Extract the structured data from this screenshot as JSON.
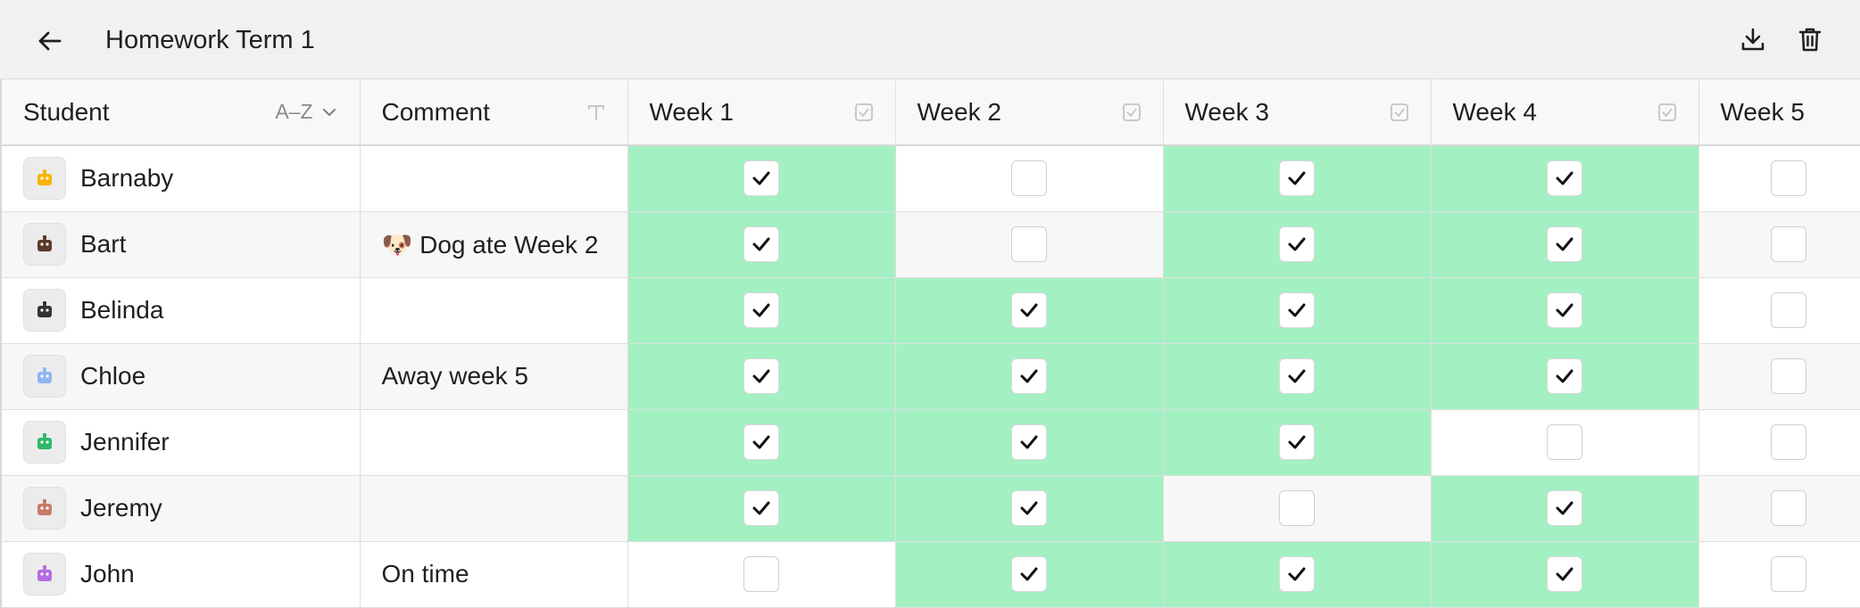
{
  "header": {
    "title": "Homework Term 1",
    "back_icon": "arrow-left-icon",
    "download_icon": "download-icon",
    "delete_icon": "trash-icon"
  },
  "columns": {
    "student": "Student",
    "sort_label": "A–Z",
    "comment": "Comment",
    "weeks": [
      "Week 1",
      "Week 2",
      "Week 3",
      "Week 4",
      "Week 5"
    ]
  },
  "colors": {
    "checked_bg": "#a3f0c3",
    "unchecked_bg": "#ffffff"
  },
  "rows": [
    {
      "name": "Barnaby",
      "avatar": "robot-avatar-icon",
      "avatar_color": "#f5b400",
      "comment": "",
      "weeks": [
        true,
        false,
        true,
        true,
        false
      ]
    },
    {
      "name": "Bart",
      "avatar": "bag-avatar-icon",
      "avatar_color": "#5a3a2a",
      "comment": "🐶 Dog ate Week 2",
      "weeks": [
        true,
        false,
        true,
        true,
        false
      ]
    },
    {
      "name": "Belinda",
      "avatar": "bear-avatar-icon",
      "avatar_color": "#333333",
      "comment": "",
      "weeks": [
        true,
        true,
        true,
        true,
        false
      ]
    },
    {
      "name": "Chloe",
      "avatar": "unicorn-avatar-icon",
      "avatar_color": "#8fb6f0",
      "comment": "Away week 5",
      "weeks": [
        true,
        true,
        true,
        true,
        false
      ]
    },
    {
      "name": "Jennifer",
      "avatar": "dragon-avatar-icon",
      "avatar_color": "#2fb86a",
      "comment": "",
      "weeks": [
        true,
        true,
        true,
        false,
        false
      ]
    },
    {
      "name": "Jeremy",
      "avatar": "fox-avatar-icon",
      "avatar_color": "#c77a6a",
      "comment": "",
      "weeks": [
        true,
        true,
        false,
        true,
        false
      ]
    },
    {
      "name": "John",
      "avatar": "monster-avatar-icon",
      "avatar_color": "#b46de0",
      "comment": "On time",
      "weeks": [
        false,
        true,
        true,
        true,
        false
      ]
    }
  ]
}
